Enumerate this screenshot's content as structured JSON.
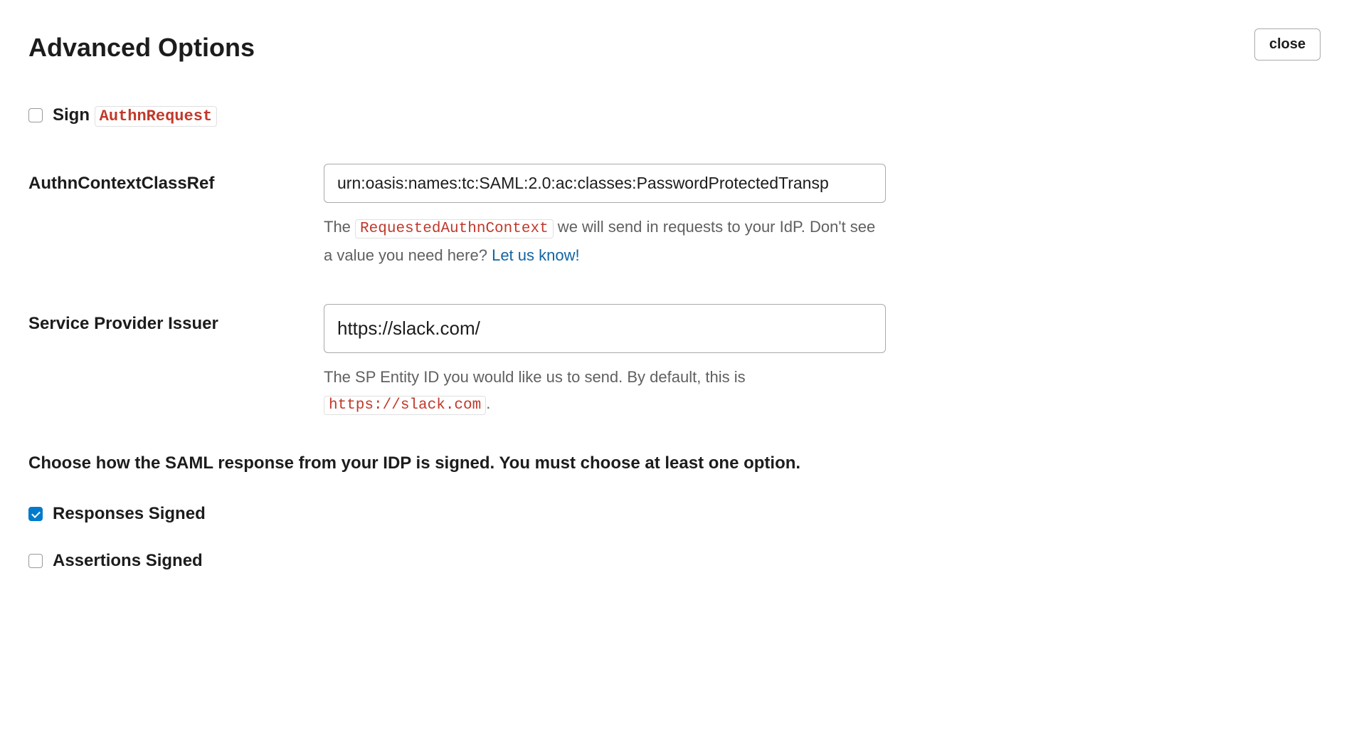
{
  "header": {
    "title": "Advanced Options",
    "close_label": "close"
  },
  "sign_authn": {
    "label_prefix": "Sign ",
    "code": "AuthnRequest",
    "checked": false
  },
  "authn_context": {
    "label": "AuthnContextClassRef",
    "value": "urn:oasis:names:tc:SAML:2.0:ac:classes:PasswordProtectedTransp",
    "help_prefix": "The ",
    "help_code": "RequestedAuthnContext",
    "help_middle": " we will send in requests to your IdP. Don't see a value you need here? ",
    "help_link": "Let us know!"
  },
  "sp_issuer": {
    "label": "Service Provider Issuer",
    "value": "https://slack.com/",
    "help_prefix": "The SP Entity ID you would like us to send. By default, this is ",
    "help_code": "https://slack.com",
    "help_suffix": "."
  },
  "signing": {
    "heading": "Choose how the SAML response from your IDP is signed. You must choose at least one option.",
    "responses_label": "Responses Signed",
    "responses_checked": true,
    "assertions_label": "Assertions Signed",
    "assertions_checked": false
  }
}
